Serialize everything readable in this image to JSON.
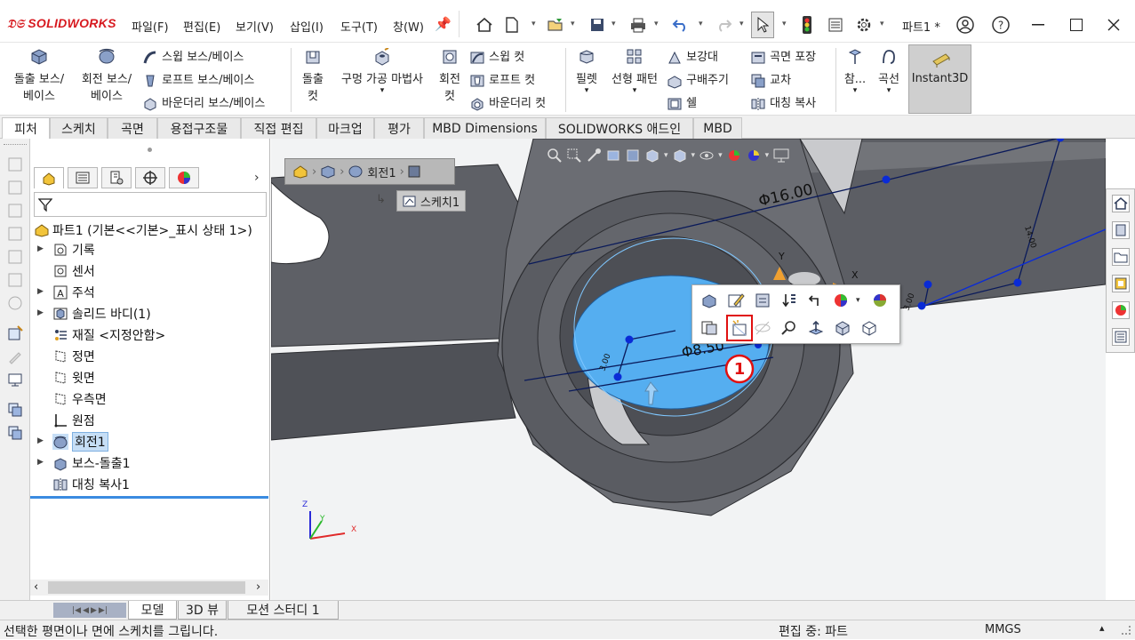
{
  "app": {
    "logo": "SOLIDWORKS",
    "document_title": "파트1 *"
  },
  "menu": [
    "파일(F)",
    "편집(E)",
    "보기(V)",
    "삽입(I)",
    "도구(T)",
    "창(W)"
  ],
  "ribbon": {
    "extrude_boss": [
      "돌출 보스/",
      "베이스"
    ],
    "revolve_boss": [
      "회전 보스/",
      "베이스"
    ],
    "sweep_boss": "스윕 보스/베이스",
    "loft_boss": "로프트 보스/베이스",
    "boundary_boss": "바운더리 보스/베이스",
    "extrude_cut": [
      "돌출",
      "컷"
    ],
    "hole_wizard": "구멍 가공 마법사",
    "revolve_cut": [
      "회전",
      "컷"
    ],
    "sweep_cut": "스윕 컷",
    "loft_cut": "로프트 컷",
    "boundary_cut": "바운더리 컷",
    "fillet": "필렛",
    "linear_pattern": "선형 패턴",
    "rib": "보강대",
    "draft": "구배주기",
    "shell": "쉘",
    "wrap": "곡면 포장",
    "intersect": "교차",
    "mirror": "대칭 복사",
    "reference": "참...",
    "curves": "곡선",
    "instant3d": "Instant3D"
  },
  "tabs": [
    "피처",
    "스케치",
    "곡면",
    "용접구조물",
    "직접 편집",
    "마크업",
    "평가",
    "MBD Dimensions",
    "SOLIDWORKS 애드인",
    "MBD"
  ],
  "tree": {
    "root": "파트1  (기본<<기본>_표시 상태 1>)",
    "items": [
      {
        "label": "기록",
        "expandable": true
      },
      {
        "label": "센서",
        "expandable": false
      },
      {
        "label": "주석",
        "expandable": true
      },
      {
        "label": "솔리드 바디(1)",
        "expandable": true
      },
      {
        "label": "재질 <지정안함>",
        "expandable": false
      },
      {
        "label": "정면",
        "expandable": false
      },
      {
        "label": "윗면",
        "expandable": false
      },
      {
        "label": "우측면",
        "expandable": false
      },
      {
        "label": "원점",
        "expandable": false
      },
      {
        "label": "회전1",
        "expandable": true,
        "selected": true
      },
      {
        "label": "보스-돌출1",
        "expandable": true
      },
      {
        "label": "대칭 복사1",
        "expandable": false
      }
    ]
  },
  "breadcrumb": {
    "revolve": "회전1",
    "sketch": "스케치1"
  },
  "dimensions": {
    "d1": "Φ16.00",
    "d2": "Φ8.50",
    "d3": "14.00",
    "d4": "3.00",
    "d5": "3.00"
  },
  "axes": {
    "x": "X",
    "y": "Y",
    "z": "Z"
  },
  "callout": "①",
  "bottom_tabs": [
    "모델",
    "3D 뷰",
    "모션 스터디 1"
  ],
  "status": {
    "message": "선택한 평면이나 면에 스케치를 그립니다.",
    "mode": "편집 중: 파트",
    "units": "MMGS"
  },
  "colors": {
    "accent_blue": "#3a8be0",
    "selection_face": "#55aef0",
    "sketch_blue": "#0a2bd6",
    "callout_red": "#e01010",
    "model_gray": "#6b6d73"
  }
}
